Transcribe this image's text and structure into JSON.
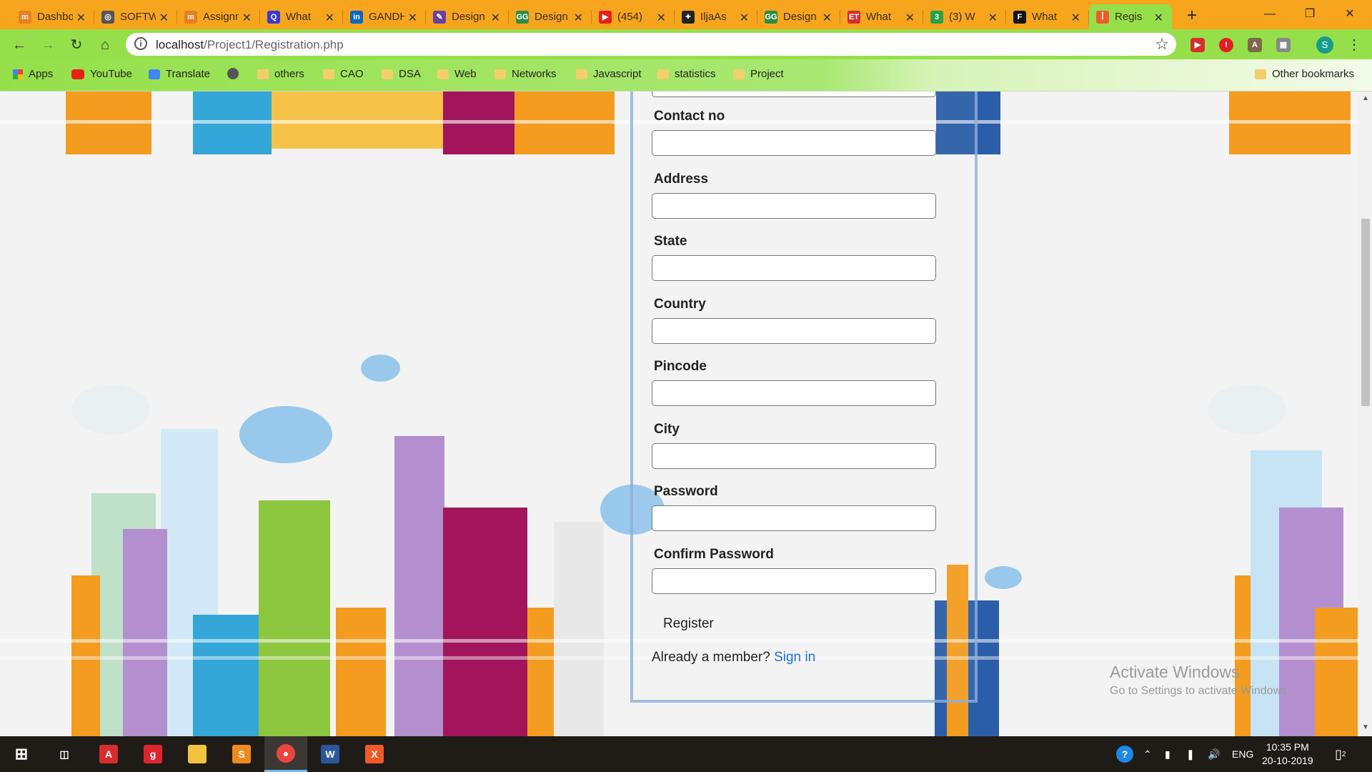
{
  "browser": {
    "tabs": [
      {
        "title": "Dashboard",
        "icon_color": "#e67e22",
        "icon_glyph": "m"
      },
      {
        "title": "SOFTWARE",
        "icon_color": "#555555",
        "icon_glyph": "◎"
      },
      {
        "title": "Assignment",
        "icon_color": "#e67e22",
        "icon_glyph": "m"
      },
      {
        "title": "What",
        "icon_color": "#3a3ad6",
        "icon_glyph": "Q"
      },
      {
        "title": "GANDHI",
        "icon_color": "#0a66c2",
        "icon_glyph": "in"
      },
      {
        "title": "Design",
        "icon_color": "#6b3fa0",
        "icon_glyph": "✎"
      },
      {
        "title": "Design",
        "icon_color": "#2f8d46",
        "icon_glyph": "GG"
      },
      {
        "title": "(454)",
        "icon_color": "#e62117",
        "icon_glyph": "▶"
      },
      {
        "title": "IljaAs",
        "icon_color": "#222222",
        "icon_glyph": "✦"
      },
      {
        "title": "Design",
        "icon_color": "#2f8d46",
        "icon_glyph": "GG"
      },
      {
        "title": "What",
        "icon_color": "#d72e2e",
        "icon_glyph": "ET"
      },
      {
        "title": "(3) W",
        "icon_color": "#25a244",
        "icon_glyph": "3"
      },
      {
        "title": "What",
        "icon_color": "#111111",
        "icon_glyph": "F"
      },
      {
        "title": "Regis",
        "icon_color": "#f05a28",
        "icon_glyph": "ꟾ",
        "active": true
      }
    ],
    "url_host": "localhost",
    "url_path": "/Project1/Registration.php",
    "profile_initial": "S",
    "bookmarks": [
      {
        "label": "Apps",
        "type": "apps"
      },
      {
        "label": "YouTube",
        "type": "youtube"
      },
      {
        "label": "Translate",
        "type": "translate"
      },
      {
        "label": "",
        "type": "globe"
      },
      {
        "label": "others",
        "type": "folder"
      },
      {
        "label": "CAO",
        "type": "folder"
      },
      {
        "label": "DSA",
        "type": "folder"
      },
      {
        "label": "Web",
        "type": "folder"
      },
      {
        "label": "Networks",
        "type": "folder"
      },
      {
        "label": "Javascript",
        "type": "folder"
      },
      {
        "label": "statistics",
        "type": "folder"
      },
      {
        "label": "Project",
        "type": "folder"
      }
    ],
    "other_bookmarks": "Other bookmarks"
  },
  "form": {
    "fields": [
      {
        "label": "Contact no"
      },
      {
        "label": "Address"
      },
      {
        "label": "State"
      },
      {
        "label": "Country"
      },
      {
        "label": "Pincode"
      },
      {
        "label": "City"
      },
      {
        "label": "Password"
      },
      {
        "label": "Confirm Password"
      }
    ],
    "register_label": "Register",
    "member_text": "Already a member?",
    "signin_label": "Sign in"
  },
  "watermark": {
    "line1": "Activate Windows",
    "line2": "Go to Settings to activate Windows."
  },
  "taskbar": {
    "apps": [
      "start",
      "task-view",
      "acrobat",
      "git",
      "file-explorer",
      "sublime",
      "chrome",
      "word",
      "xampp"
    ],
    "language": "ENG",
    "time": "10:35 PM",
    "date": "20-10-2019",
    "notifications": "2"
  }
}
